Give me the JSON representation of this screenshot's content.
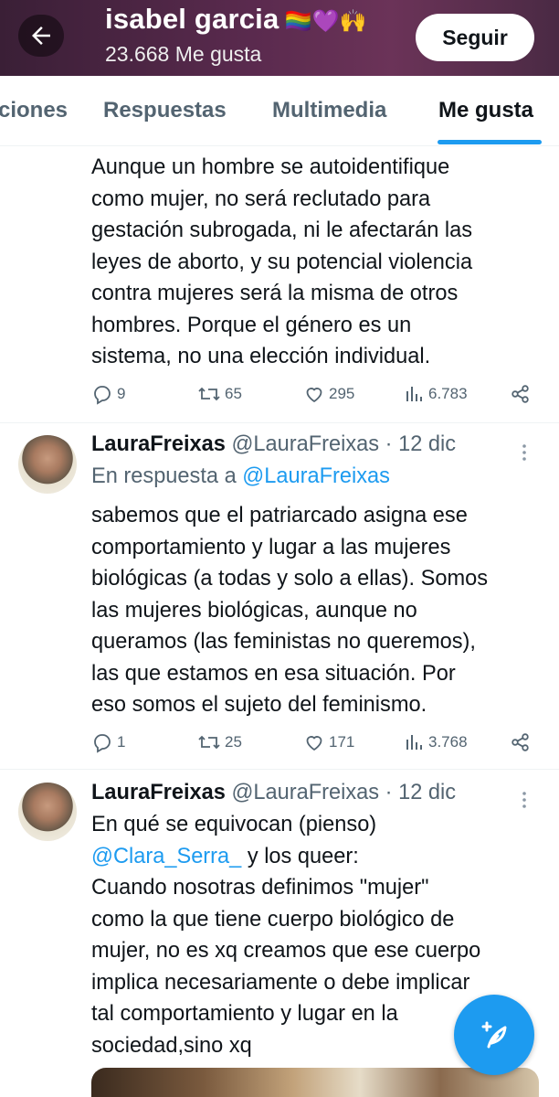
{
  "header": {
    "title": "isabel garcia",
    "emoji": "🏳️‍🌈💜🙌",
    "likes_count": "23.668 Me gusta",
    "follow_label": "Seguir"
  },
  "tabs": [
    "ciones",
    "Respuestas",
    "Multimedia",
    "Me gusta"
  ],
  "active_tab": "Me gusta",
  "tweets": [
    {
      "text_lines": [
        "Aunque un hombre se autoidentifique",
        "como mujer, no será reclutado para",
        "gestación subrogada, ni le afectarán las",
        "leyes de aborto, y su potencial violencia",
        "contra mujeres será la misma de otros",
        "hombres. Porque el género es un",
        "sistema, no una elección individual."
      ],
      "replies": "9",
      "retweets": "65",
      "likes": "295",
      "views": "6.783"
    },
    {
      "name": "LauraFreixas",
      "handle": "@LauraFreixas",
      "date": "· 12 dic",
      "reply_prefix": "En respuesta a",
      "reply_to": "@LauraFreixas",
      "text_lines": [
        "sabemos que el patriarcado asigna ese",
        "comportamiento y lugar a las mujeres",
        "biológicas (a todas y solo a ellas). Somos",
        "las mujeres biológicas, aunque no",
        "queramos (las feministas no queremos),",
        "las que estamos en esa situación. Por",
        "eso somos el sujeto del feminismo."
      ],
      "replies": "1",
      "retweets": "25",
      "likes": "171",
      "views": "3.768"
    },
    {
      "name": "LauraFreixas",
      "handle": "@LauraFreixas",
      "date": "· 12 dic",
      "line1": "En qué se equivocan (pienso)",
      "mention": "@Clara_Serra_",
      "mention_suffix": " y los queer:",
      "text_lines": [
        "Cuando nosotras definimos \"mujer\"",
        "como la que tiene cuerpo biológico de",
        "mujer, no es xq creamos que ese cuerpo",
        "implica necesariamente o debe implicar",
        "tal comportamiento y lugar en la",
        "sociedad,sino xq"
      ]
    }
  ],
  "icons": {
    "back": "arrow-left-icon",
    "reply": "reply-icon",
    "retweet": "retweet-icon",
    "like": "heart-icon",
    "views": "views-icon",
    "share": "share-icon",
    "more": "more-vertical-icon",
    "compose": "compose-feather-icon"
  },
  "colors": {
    "accent": "#1d9bf0",
    "secondary_text": "#536471",
    "header_bg": "#4a2a44"
  }
}
